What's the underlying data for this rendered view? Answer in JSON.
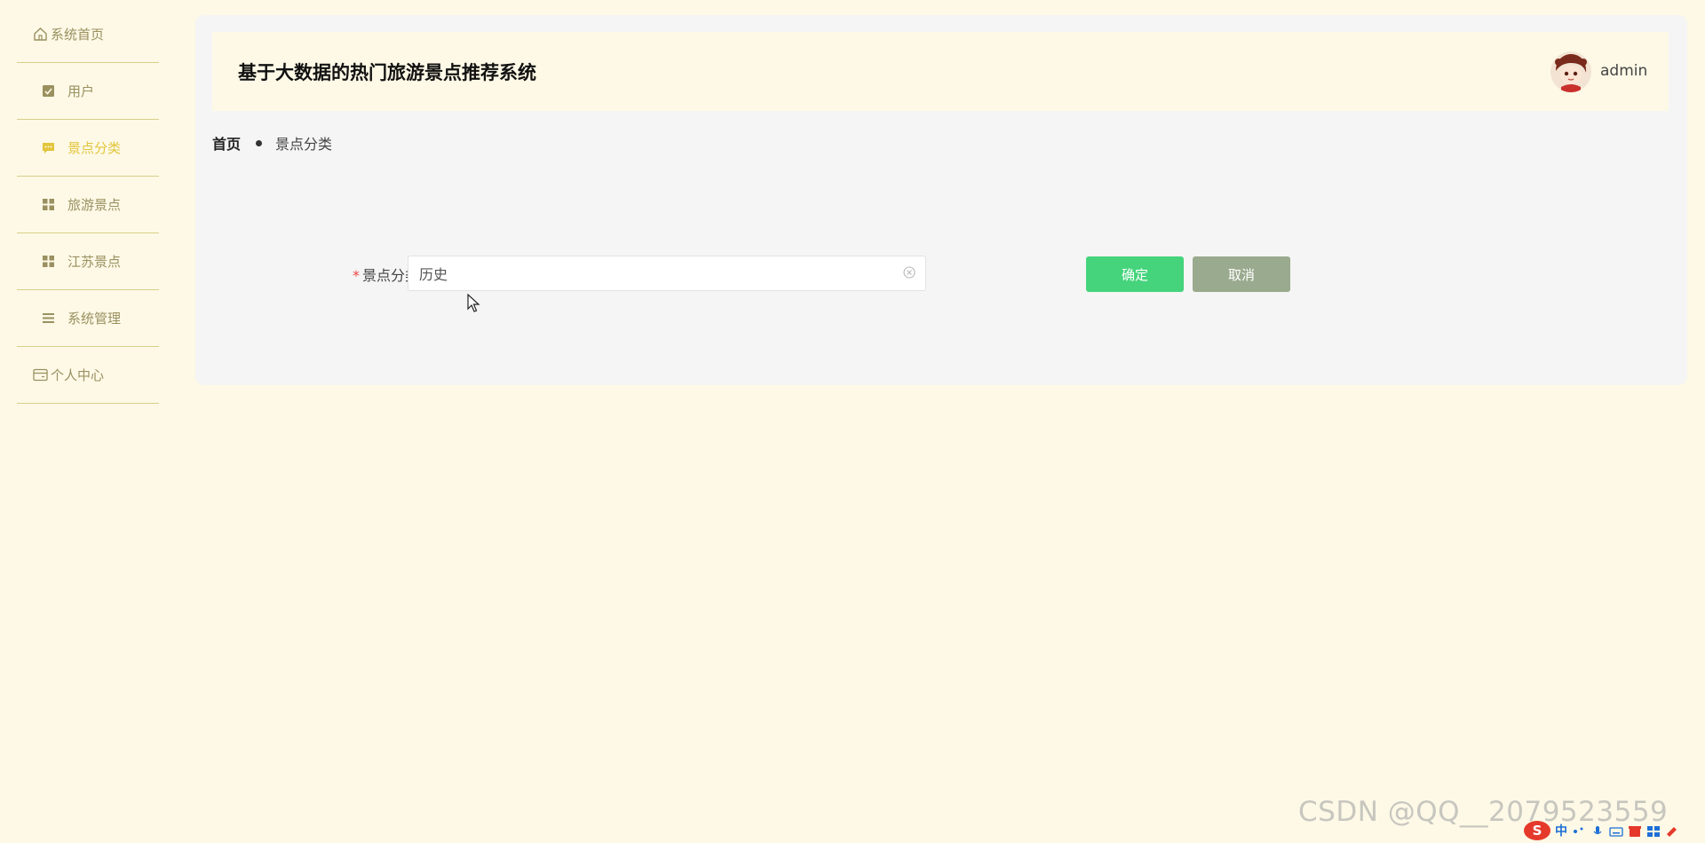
{
  "sidebar": {
    "items": [
      {
        "label": "系统首页",
        "icon": "home-icon"
      },
      {
        "label": "用户",
        "icon": "check-square-icon"
      },
      {
        "label": "景点分类",
        "icon": "message-icon",
        "active": true
      },
      {
        "label": "旅游景点",
        "icon": "grid-icon"
      },
      {
        "label": "江苏景点",
        "icon": "grid-icon"
      },
      {
        "label": "系统管理",
        "icon": "list-icon"
      },
      {
        "label": "个人中心",
        "icon": "card-icon"
      }
    ]
  },
  "header": {
    "title": "基于大数据的热门旅游景点推荐系统",
    "username": "admin"
  },
  "breadcrumb": {
    "home": "首页",
    "current": "景点分类"
  },
  "form": {
    "required_mark": "*",
    "label": "景点分类",
    "value": "历史",
    "confirm_label": "确定",
    "cancel_label": "取消"
  },
  "watermark": "CSDN @QQ__2079523559",
  "tray": {
    "logo": "S",
    "ime": "中"
  },
  "colors": {
    "background": "#fdf9e6",
    "accent": "#e3c53c",
    "confirm": "#45d47c",
    "cancel": "#9aaa8e"
  }
}
